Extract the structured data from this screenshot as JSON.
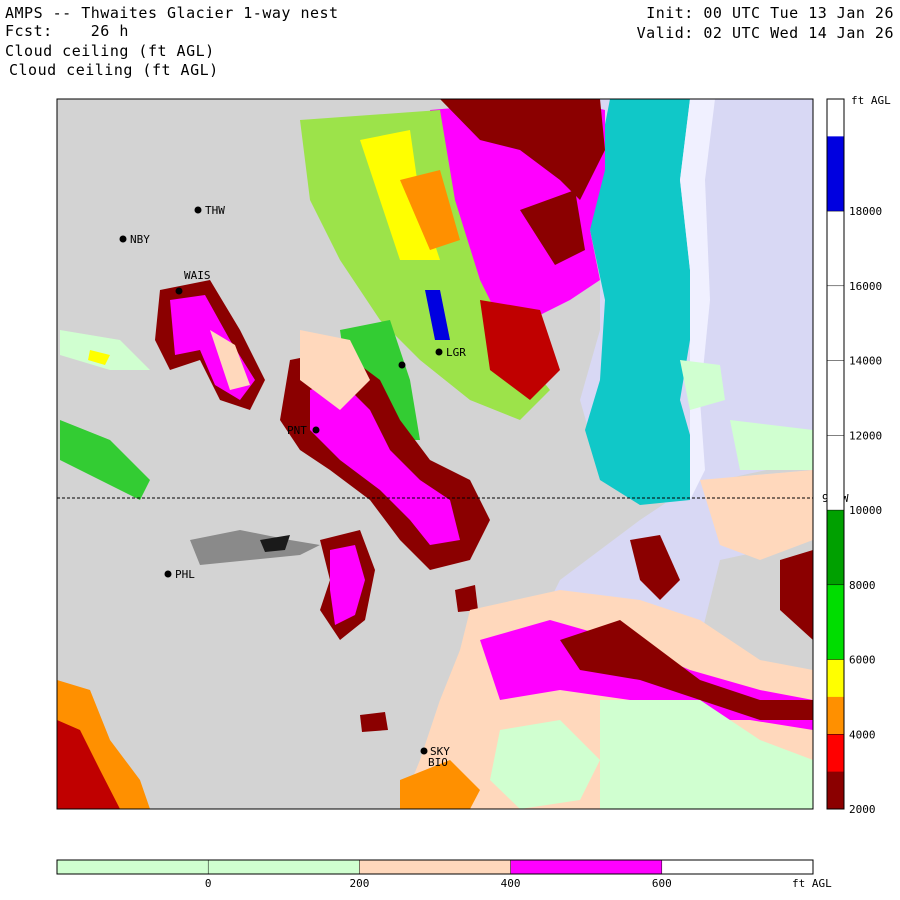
{
  "header": {
    "title": "AMPS -- Thwaites Glacier 1-way nest",
    "fcst": "Fcst:    26 h",
    "field_line1": "Cloud ceiling (ft AGL)",
    "field_line2": "Cloud ceiling (ft AGL)",
    "init": "Init: 00 UTC Tue 13 Jan 26",
    "valid": "Valid: 02 UTC Wed 14 Jan 26"
  },
  "map": {
    "stations": [
      {
        "id": "THW",
        "label": "THW"
      },
      {
        "id": "NBY",
        "label": "NBY"
      },
      {
        "id": "WAIS",
        "label": "WAIS"
      },
      {
        "id": "LGR",
        "label": "LGR"
      },
      {
        "id": "PNT",
        "label": "PNT"
      },
      {
        "id": "PHL",
        "label": "PHL"
      },
      {
        "id": "SKY",
        "label": "SKY"
      },
      {
        "id": "BIO",
        "label": "BIO"
      }
    ],
    "latitude_label": "90 W",
    "colors": {
      "background_ice": "#d3d3d3",
      "ocean_sea_ice": "#d8d8f4",
      "cyan": "#10c8c8",
      "magenta": "#ff00ff",
      "dark_red": "#8b0000",
      "peach": "#ffd8bc",
      "light_green": "#d0ffd0"
    }
  },
  "right_colorbar": {
    "unit": "ft AGL",
    "ticks": [
      "18000",
      "16000",
      "14000",
      "12000",
      "10000",
      "8000",
      "6000",
      "4000",
      "2000"
    ],
    "colors_top_to_bottom": [
      "#ffffff",
      "#0000e0",
      "#0000e0",
      "#ffffff",
      "#ffffff",
      "#ffffff",
      "#ffffff",
      "#ffffff",
      "#ffffff",
      "#ffffff",
      "#ffffff",
      "#00a000",
      "#00a000",
      "#00dd00",
      "#00dd00",
      "#ffff00",
      "#ff9000",
      "#ff0000",
      "#8b0000"
    ]
  },
  "bottom_colorbar": {
    "unit": "ft AGL",
    "ticks": [
      "0",
      "200",
      "400",
      "600"
    ],
    "colors_left_to_right": [
      "#d0ffd0",
      "#d0ffd0",
      "#ffd8bc",
      "#ff00ff",
      "#ffffff"
    ]
  }
}
